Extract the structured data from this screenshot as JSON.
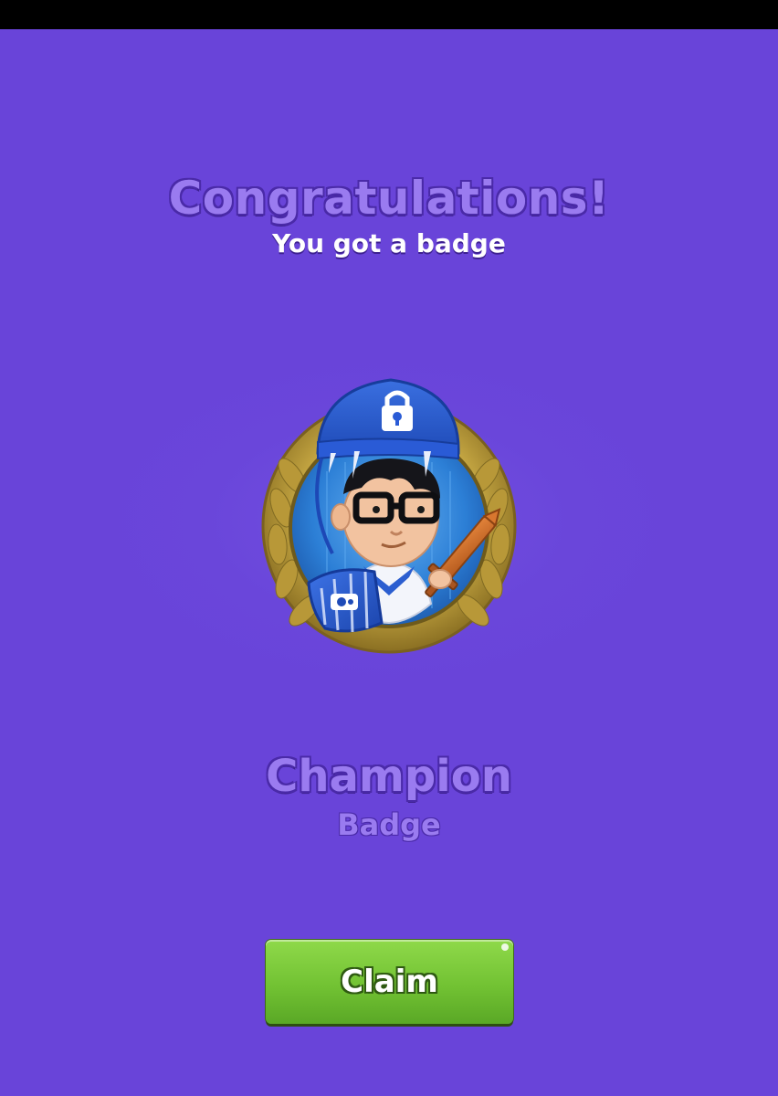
{
  "header": {
    "title": "Congratulations!",
    "subtitle": "You got a badge"
  },
  "badge": {
    "name": "Champion",
    "type": "Badge",
    "image_icon": "champion-badge-medal-icon"
  },
  "actions": {
    "claim_label": "Claim"
  },
  "colors": {
    "background": "#6944d9",
    "title_text": "#9a7bf0",
    "button_green": "#72c233",
    "medal_gold": "#c9a93e",
    "bucket_blue": "#2d5fd3"
  }
}
